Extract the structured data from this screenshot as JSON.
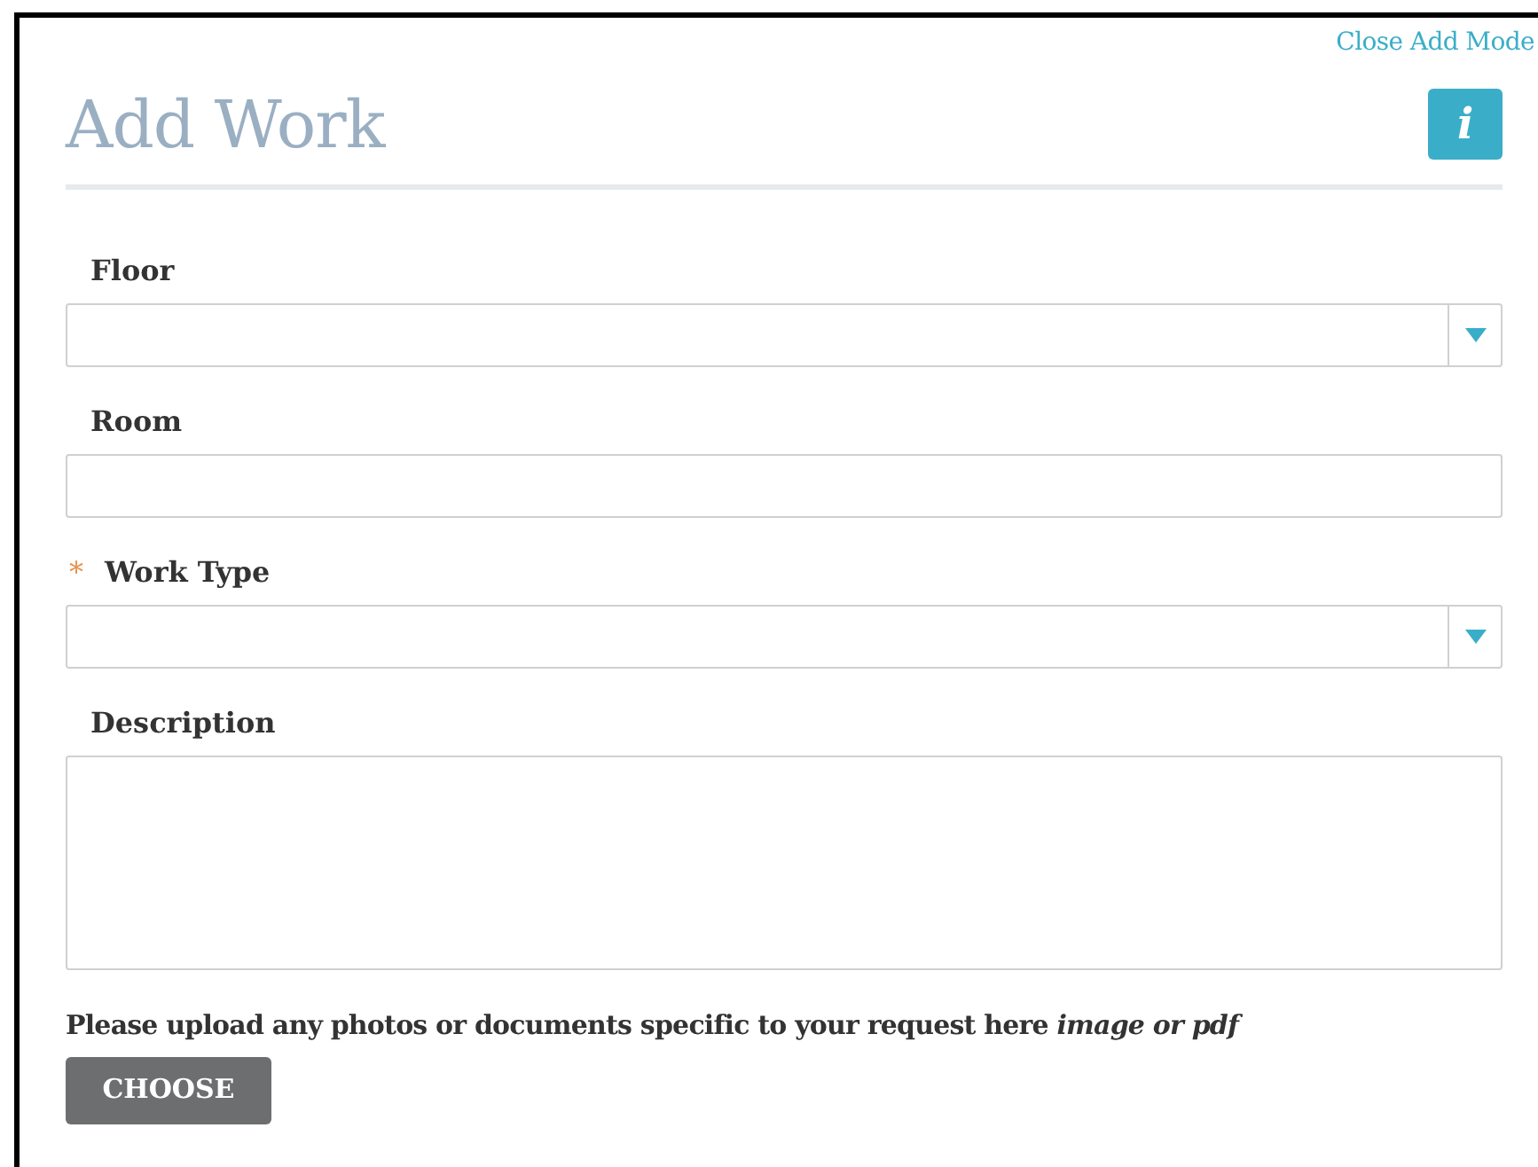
{
  "close_link": "Close Add Mode",
  "title": "Add Work",
  "info_button": "i",
  "fields": [
    {
      "kind": "select",
      "label": "Floor"
    },
    {
      "kind": "text",
      "label": "Room"
    },
    {
      "kind": "select",
      "label": "Work Type",
      "required_mark": "*"
    },
    {
      "kind": "textarea",
      "label": "Description"
    }
  ],
  "upload": {
    "text": "Please upload any photos or documents specific to your request here *image or pdf*",
    "button": "CHOOSE"
  }
}
